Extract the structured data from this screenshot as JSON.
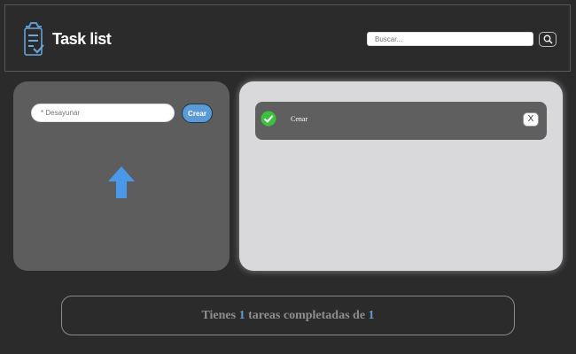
{
  "header": {
    "app_title": "Task list",
    "search_placeholder": "Buscar...",
    "logo_icon": "clipboard-list-icon",
    "search_icon": "search-icon"
  },
  "left_panel": {
    "input_placeholder": "* Desayunar",
    "create_label": "Crear",
    "arrow_icon": "arrow-up-icon"
  },
  "tasks": [
    {
      "label": "Cenar",
      "completed": true,
      "delete_label": "X",
      "check_icon": "check-circle-icon"
    }
  ],
  "footer": {
    "prefix": "Tienes",
    "completed_count": "1",
    "middle": "tareas completadas de",
    "total_count": "1"
  },
  "colors": {
    "background": "#2b2b2b",
    "panel_dark": "#5d5d5d",
    "panel_light": "#d9d9db",
    "task_bg": "#5f5f5f",
    "accent": "#5b9bd5",
    "check_green": "#3ec13e"
  }
}
